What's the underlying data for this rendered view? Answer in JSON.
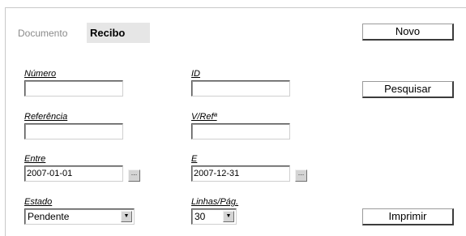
{
  "document": {
    "label": "Documento",
    "value": "Recibo"
  },
  "buttons": {
    "novo": "Novo",
    "pesquisar": "Pesquisar",
    "imprimir": "Imprimir"
  },
  "fields": {
    "numero": {
      "label": "Número",
      "value": ""
    },
    "id": {
      "label": "ID",
      "value": ""
    },
    "referencia": {
      "label": "Referência",
      "value": ""
    },
    "vref": {
      "label": "V/Refª",
      "value": ""
    },
    "entre": {
      "label": "Entre",
      "value": "2007-01-01"
    },
    "e": {
      "label": "E",
      "value": "2007-12-31"
    },
    "estado": {
      "label": "Estado",
      "value": "Pendente"
    },
    "linhas": {
      "label": "Linhas/Pág.",
      "value": "30"
    }
  },
  "icons": {
    "date_picker": "ellipsis-button",
    "dropdown": "chevron-down-icon"
  }
}
